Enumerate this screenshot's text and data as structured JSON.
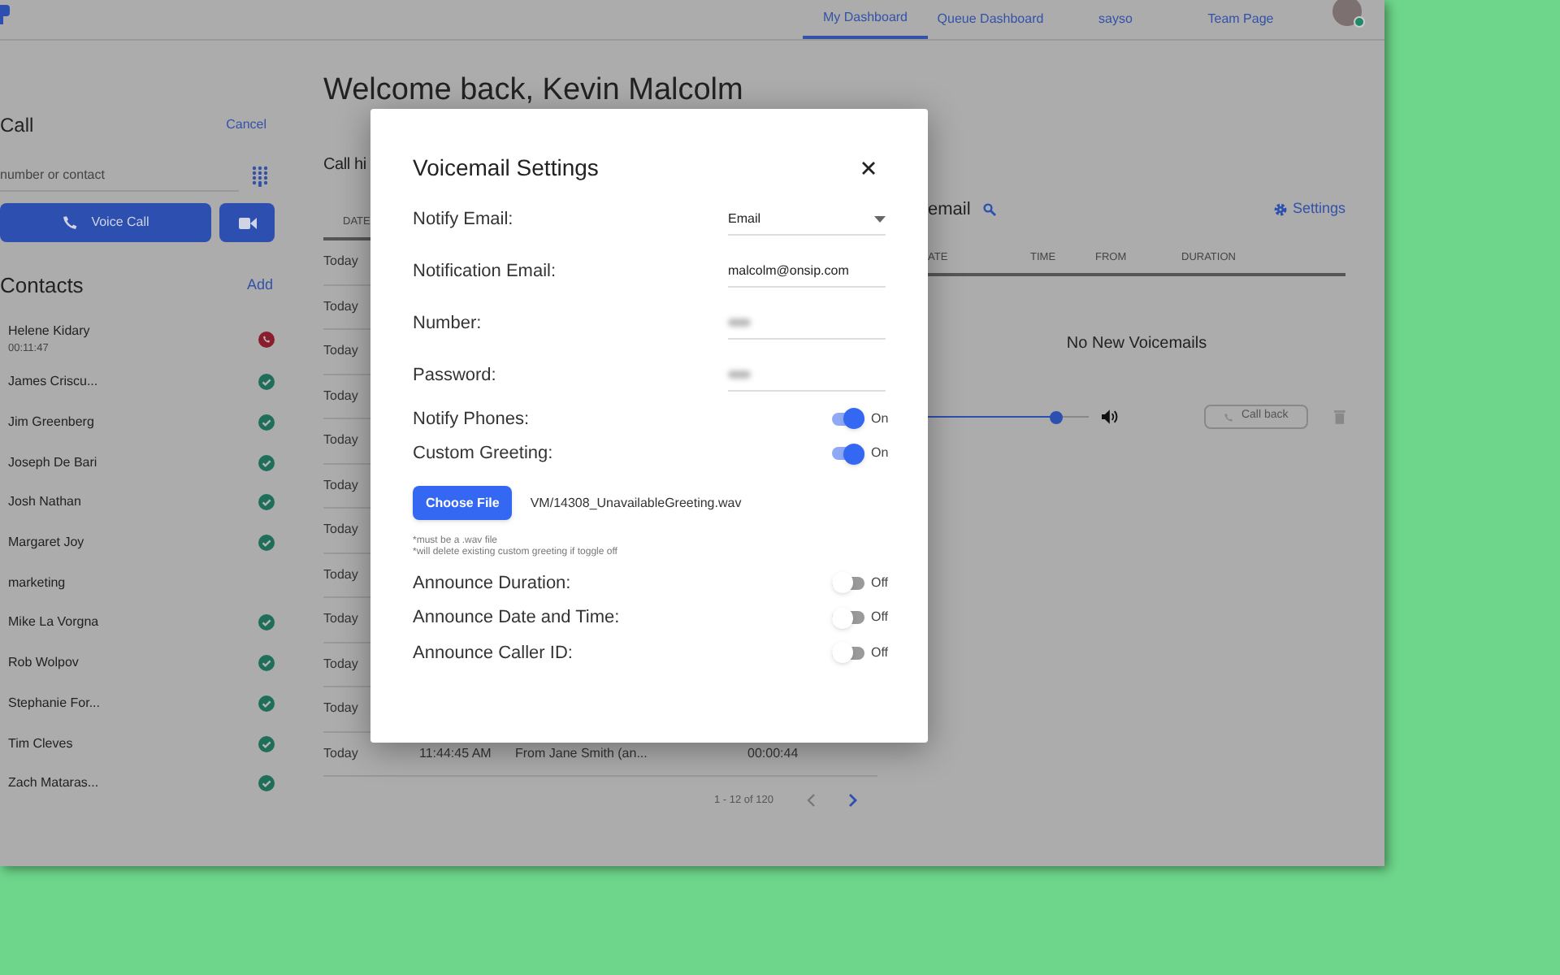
{
  "nav": {
    "tabs": [
      {
        "label": "My Dashboard",
        "selected": true
      },
      {
        "label": "Queue Dashboard",
        "selected": false
      },
      {
        "label": "sayso",
        "selected": false
      },
      {
        "label": "Team Page",
        "selected": false
      }
    ]
  },
  "call_panel": {
    "title": "Call",
    "cancel": "Cancel",
    "search": {
      "placeholder": "number or contact"
    },
    "voice_call": "Voice Call"
  },
  "contacts": {
    "title": "Contacts",
    "add": "Add",
    "items": [
      {
        "name": "Helene Kidary",
        "subtitle": "00:11:47",
        "kind": "on-call"
      },
      {
        "name": "James Criscu...",
        "kind": "available"
      },
      {
        "name": "Jim Greenberg",
        "kind": "available"
      },
      {
        "name": "Joseph De Bari",
        "kind": "available"
      },
      {
        "name": "Josh Nathan",
        "kind": "available"
      },
      {
        "name": "Margaret Joy",
        "kind": "available"
      },
      {
        "name": "marketing",
        "kind": "group"
      },
      {
        "name": "Mike La Vorgna",
        "kind": "available"
      },
      {
        "name": "Rob Wolpov",
        "kind": "available"
      },
      {
        "name": "Stephanie For...",
        "kind": "available"
      },
      {
        "name": "Tim Cleves",
        "kind": "available"
      },
      {
        "name": "Zach Mataras...",
        "kind": "available"
      }
    ]
  },
  "welcome": "Welcome back, Kevin Malcolm",
  "call_history": {
    "title": "Call hi",
    "columns": [
      "DATE"
    ],
    "rows": [
      [
        "Today"
      ],
      [
        "Today"
      ],
      [
        "Today"
      ],
      [
        "Today"
      ],
      [
        "Today"
      ],
      [
        "Today"
      ],
      [
        "Today"
      ],
      [
        "Today"
      ],
      [
        "Today"
      ],
      [
        "Today"
      ],
      [
        "Today"
      ],
      [
        "Today",
        "11:44:45 AM",
        "From Jane Smith (an...",
        "00:00:44"
      ]
    ],
    "pagination": "1 - 12 of 120"
  },
  "voicemail": {
    "title": "email",
    "settings": "Settings",
    "columns": [
      "ATE",
      "TIME",
      "FROM",
      "DURATION"
    ],
    "empty": "No New Voicemails",
    "player": {
      "level": 0.8
    },
    "call_back": "Call back"
  },
  "modal": {
    "title": "Voicemail Settings",
    "items": [
      {
        "kind": "select",
        "label": "Notify Email:",
        "value": "Email"
      },
      {
        "kind": "text",
        "label": "Notification Email:",
        "value": "malcolm@onsip.com"
      },
      {
        "kind": "masked",
        "label": "Number:"
      },
      {
        "kind": "masked",
        "label": "Password:"
      },
      {
        "kind": "toggle",
        "label": "Notify Phones:",
        "on": true,
        "state_label": "On"
      },
      {
        "kind": "toggle",
        "label": "Custom Greeting:",
        "on": true,
        "state_label": "On"
      },
      {
        "kind": "file",
        "button": "Choose File",
        "filename": "VM/14308_UnavailableGreeting.wav",
        "notes": [
          "*must be a .wav file",
          "*will delete existing custom greeting if toggle off"
        ]
      },
      {
        "kind": "toggle",
        "label": "Announce Duration:",
        "on": false,
        "state_label": "Off"
      },
      {
        "kind": "toggle",
        "label": "Announce Date and Time:",
        "on": false,
        "state_label": "Off"
      },
      {
        "kind": "toggle",
        "label": "Announce Caller ID:",
        "on": false,
        "state_label": "Off"
      }
    ]
  }
}
